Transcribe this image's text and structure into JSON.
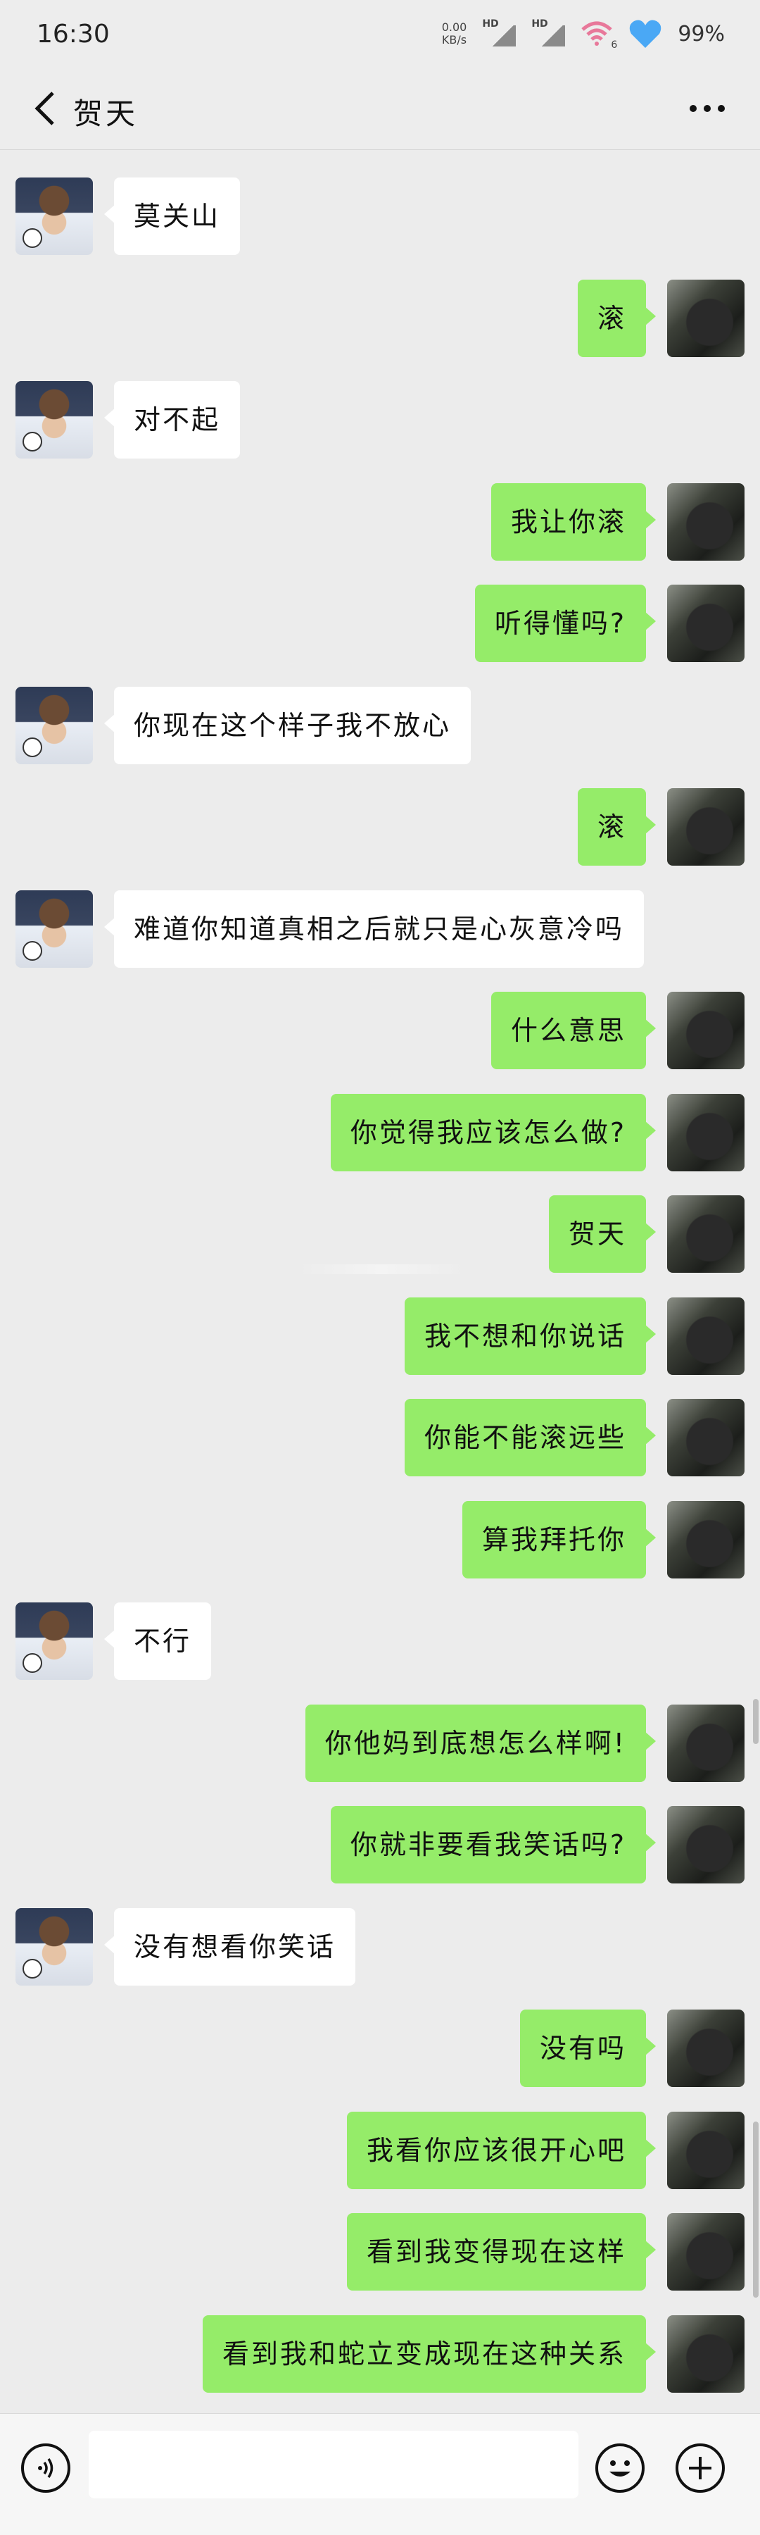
{
  "status_bar": {
    "time": "16:30",
    "net_speed_value": "0.00",
    "net_speed_unit": "KB/s",
    "sim1_label": "HD",
    "sim2_label": "HD",
    "wifi_label": "6",
    "battery": "99%"
  },
  "header": {
    "title": "贺天"
  },
  "messages": [
    {
      "side": "left",
      "text": "莫关山"
    },
    {
      "side": "right",
      "text": "滚"
    },
    {
      "side": "left",
      "text": "对不起"
    },
    {
      "side": "right",
      "text": "我让你滚"
    },
    {
      "side": "right",
      "text": "听得懂吗?"
    },
    {
      "side": "left",
      "text": "你现在这个样子我不放心"
    },
    {
      "side": "right",
      "text": "滚"
    },
    {
      "side": "left",
      "text": "难道你知道真相之后就只是心灰意冷吗"
    },
    {
      "side": "right",
      "text": "什么意思"
    },
    {
      "side": "right",
      "text": "你觉得我应该怎么做?"
    },
    {
      "side": "right",
      "text": "贺天"
    },
    {
      "side": "right",
      "text": "我不想和你说话"
    },
    {
      "side": "right",
      "text": "你能不能滚远些"
    },
    {
      "side": "right",
      "text": "算我拜托你"
    },
    {
      "side": "left",
      "text": "不行"
    },
    {
      "side": "right",
      "text": "你他妈到底想怎么样啊!"
    },
    {
      "side": "right",
      "text": "你就非要看我笑话吗?"
    },
    {
      "side": "left",
      "text": "没有想看你笑话"
    },
    {
      "side": "right",
      "text": "没有吗"
    },
    {
      "side": "right",
      "text": "我看你应该很开心吧"
    },
    {
      "side": "right",
      "text": "看到我变得现在这样"
    },
    {
      "side": "right",
      "text": "看到我和蛇立变成现在这种关系"
    }
  ],
  "input_bar": {
    "placeholder": ""
  },
  "colors": {
    "background": "#ececec",
    "sent_bubble": "#95ec69",
    "received_bubble": "#ffffff",
    "wifi_icon": "#e8789a",
    "heart_icon": "#4aa8f5"
  },
  "icons": {
    "back": "chevron-left-icon",
    "more": "more-dots-icon",
    "voice": "voice-icon",
    "emoji": "emoji-icon",
    "plus": "plus-icon"
  }
}
